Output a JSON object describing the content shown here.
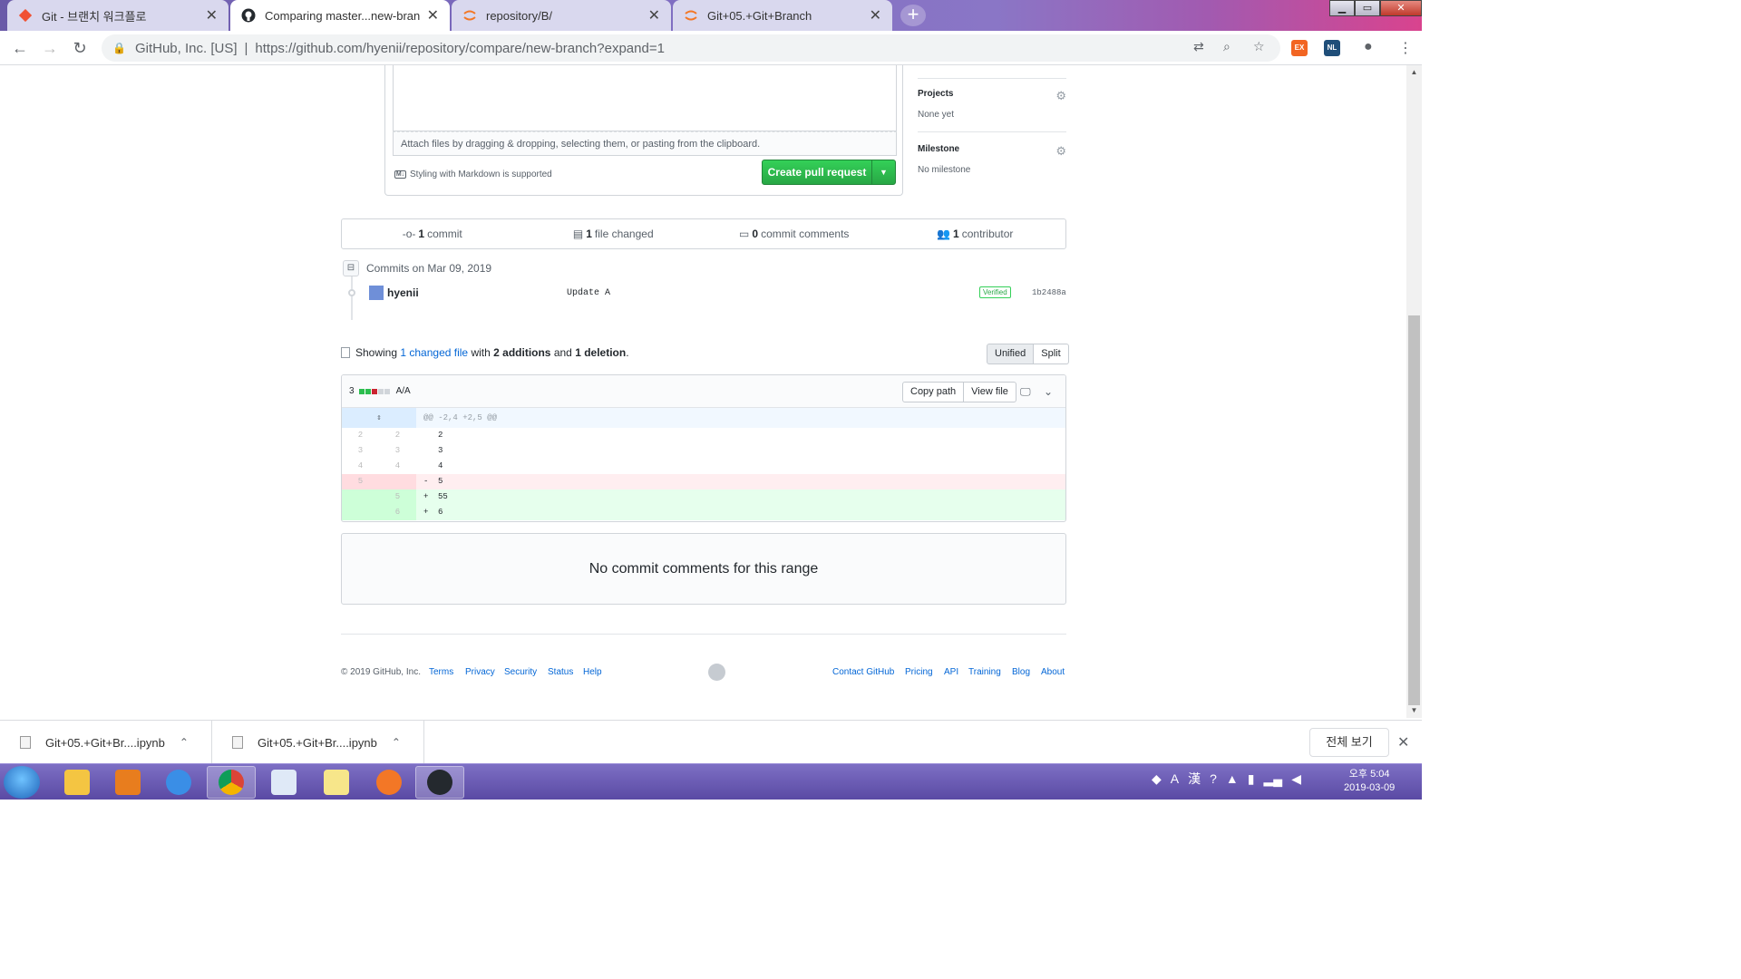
{
  "browser": {
    "tabs": [
      {
        "title": "Git - 브랜치 워크플로",
        "icon": "git-icon",
        "active": false
      },
      {
        "title": "Comparing master...new-branch",
        "icon": "github-icon",
        "active": true
      },
      {
        "title": "repository/B/",
        "icon": "jupyter-icon",
        "active": false
      },
      {
        "title": "Git+05.+Git+Branch",
        "icon": "jupyter-icon",
        "active": false
      }
    ],
    "new_tab": "+",
    "address": {
      "cert": "GitHub, Inc. [US]",
      "separator": "|",
      "url": "https://github.com/hyenii/repository/compare/new-branch?expand=1"
    },
    "extensions": [
      "EX",
      "NL"
    ]
  },
  "form": {
    "attach_text": "Attach files by dragging & dropping, selecting them, or pasting from the clipboard.",
    "markdown_note": "Styling with Markdown is supported",
    "markdown_icon": "M↓",
    "create_button": "Create pull request"
  },
  "sidebar": {
    "projects": {
      "title": "Projects",
      "value": "None yet"
    },
    "milestone": {
      "title": "Milestone",
      "value": "No milestone"
    }
  },
  "numbers": [
    {
      "icon": "commit-icon",
      "count": "1",
      "label": "commit"
    },
    {
      "icon": "file-diff-icon",
      "count": "1",
      "label": "file changed"
    },
    {
      "icon": "comment-icon",
      "count": "0",
      "label": "commit comments"
    },
    {
      "icon": "people-icon",
      "count": "1",
      "label": "contributor"
    }
  ],
  "commits": {
    "header": "Commits on Mar 09, 2019",
    "items": [
      {
        "author": "hyenii",
        "message": "Update A",
        "verified": "Verified",
        "sha": "1b2488a"
      }
    ]
  },
  "toc": {
    "showing": "Showing",
    "changed_link": "1 changed file",
    "with": "with",
    "additions": "2 additions",
    "and": "and",
    "deletions": "1 deletion",
    "end": "."
  },
  "diff_view": {
    "unified": "Unified",
    "split": "Split"
  },
  "file": {
    "change_count": "3",
    "name": "A/A",
    "copy_path": "Copy path",
    "view_file": "View file",
    "hunk": "@@ -2,4 +2,5 @@",
    "lines": [
      {
        "old": "2",
        "new": "2",
        "type": "context",
        "sign": "",
        "text": "2"
      },
      {
        "old": "3",
        "new": "3",
        "type": "context",
        "sign": "",
        "text": "3"
      },
      {
        "old": "4",
        "new": "4",
        "type": "context",
        "sign": "",
        "text": "4"
      },
      {
        "old": "5",
        "new": "",
        "type": "del",
        "sign": "-",
        "text": "5"
      },
      {
        "old": "",
        "new": "5",
        "type": "add",
        "sign": "+",
        "text": "55"
      },
      {
        "old": "",
        "new": "6",
        "type": "add",
        "sign": "+",
        "text": "6"
      }
    ]
  },
  "no_comments": "No commit comments for this range",
  "footer": {
    "copyright": "© 2019 GitHub, Inc.",
    "left_links": [
      "Terms",
      "Privacy",
      "Security",
      "Status",
      "Help"
    ],
    "right_links": [
      "Contact GitHub",
      "Pricing",
      "API",
      "Training",
      "Blog",
      "About"
    ]
  },
  "downloads": {
    "items": [
      "Git+05.+Git+Br....ipynb",
      "Git+05.+Git+Br....ipynb"
    ],
    "show_all": "전체 보기"
  },
  "taskbar": {
    "clock_time": "오후 5:04",
    "clock_date": "2019-03-09",
    "tray_ime": "A",
    "tray_hanja": "漢"
  },
  "colors": {
    "tab_strip": "#7d6cc0",
    "create_button": "#28a745",
    "link": "#0366d6",
    "diff_add": "#e6ffed",
    "diff_del": "#ffeef0",
    "taskbar": "#5a4aa4"
  }
}
